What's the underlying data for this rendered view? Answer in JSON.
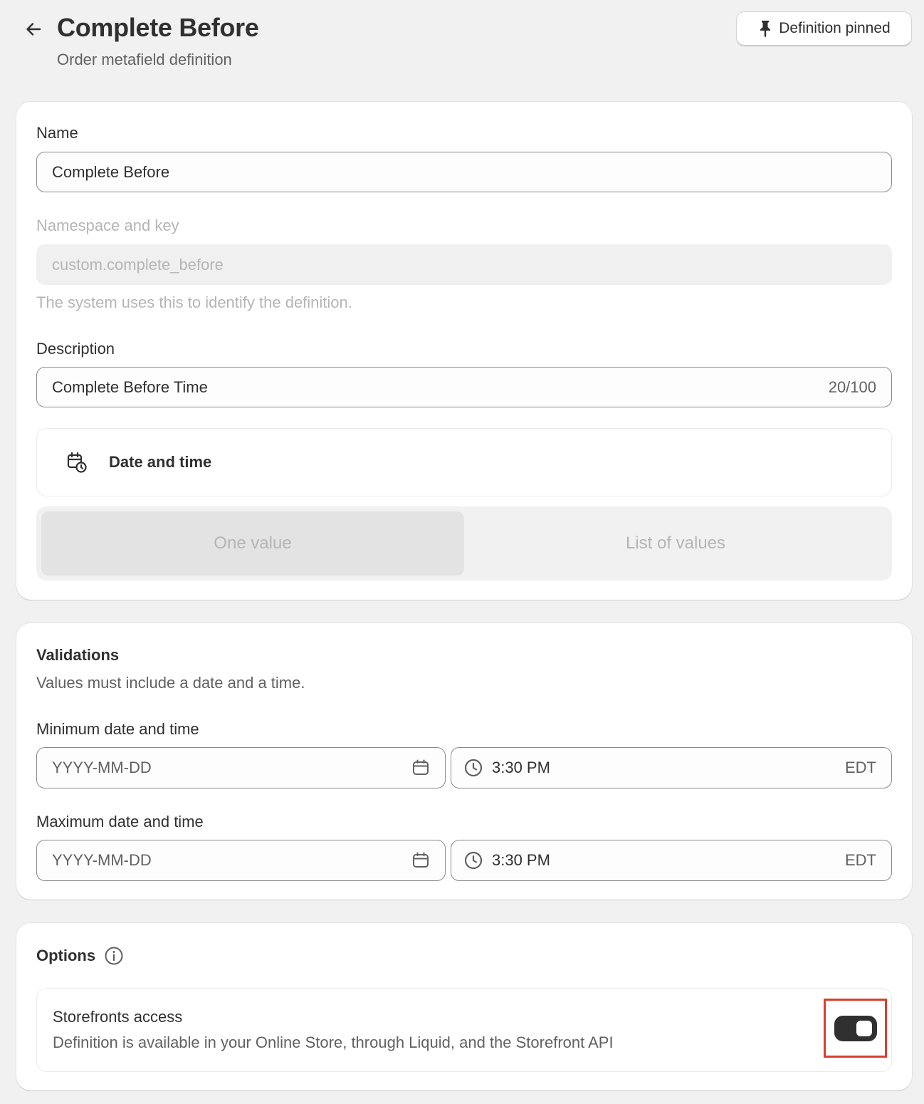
{
  "header": {
    "title": "Complete Before",
    "subtitle": "Order metafield definition",
    "pin_button": "Definition pinned"
  },
  "definition": {
    "name_label": "Name",
    "name_value": "Complete Before",
    "namespace_label": "Namespace and key",
    "namespace_value": "custom.complete_before",
    "namespace_help": "The system uses this to identify the definition.",
    "description_label": "Description",
    "description_value": "Complete Before Time",
    "description_count": "20/100",
    "type_label": "Date and time",
    "value_options": [
      "One value",
      "List of values"
    ],
    "selected_option": "One value"
  },
  "validations": {
    "title": "Validations",
    "subtitle": "Values must include a date and a time.",
    "min_label": "Minimum date and time",
    "min_date_placeholder": "YYYY-MM-DD",
    "min_time": "3:30 PM",
    "min_tz": "EDT",
    "max_label": "Maximum date and time",
    "max_date_placeholder": "YYYY-MM-DD",
    "max_time": "3:30 PM",
    "max_tz": "EDT"
  },
  "options": {
    "title": "Options",
    "storefront_title": "Storefronts access",
    "storefront_desc": "Definition is available in your Online Store, through Liquid, and the Storefront API",
    "storefront_enabled": true
  },
  "colors": {
    "highlight": "#d93f2e",
    "toggle_on": "#303030"
  }
}
